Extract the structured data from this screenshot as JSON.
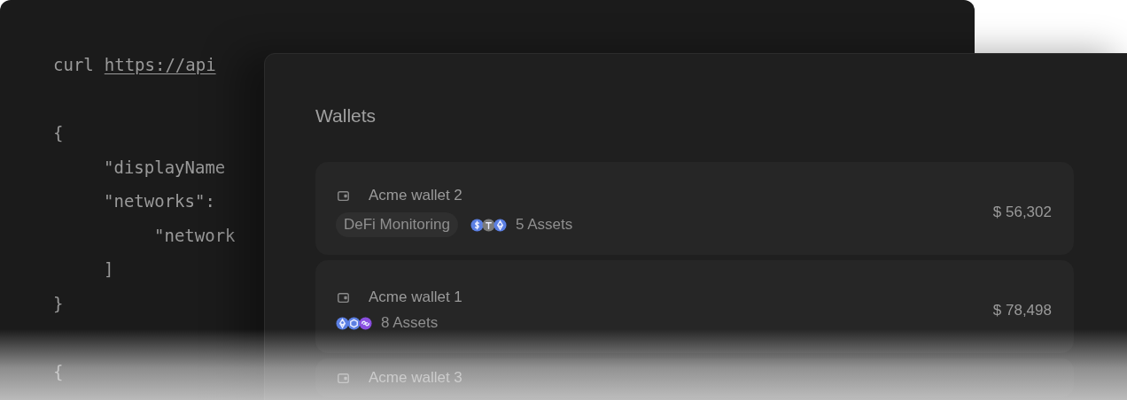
{
  "code_panel": {
    "lines": [
      {
        "kind": "code",
        "parts": [
          {
            "kind": "text",
            "text": "curl"
          },
          {
            "kind": "link",
            "text": "https://api"
          }
        ]
      },
      {
        "kind": "blank"
      },
      {
        "kind": "code",
        "parts": [
          {
            "kind": "text",
            "text": "{"
          }
        ],
        "children": [
          {
            "kind": "code",
            "parts": [
              {
                "kind": "text",
                "text": "\"displayName"
              }
            ]
          },
          {
            "kind": "code",
            "parts": [
              {
                "kind": "text",
                "text": "\"networks\":"
              }
            ],
            "children": [
              {
                "kind": "code",
                "parts": [
                  {
                    "kind": "text",
                    "text": "\"network"
                  }
                ]
              }
            ]
          },
          {
            "kind": "code",
            "parts": [
              {
                "kind": "text",
                "text": "]"
              }
            ]
          }
        ]
      },
      {
        "kind": "code",
        "parts": [
          {
            "kind": "text",
            "text": "}"
          }
        ]
      },
      {
        "kind": "blank"
      },
      {
        "kind": "code",
        "parts": [
          {
            "kind": "text",
            "text": "{"
          }
        ]
      }
    ]
  },
  "wallets_panel": {
    "title": "Wallets",
    "wallets": [
      {
        "name": "Acme wallet 2",
        "tag": "DeFi Monitoring",
        "coins": [
          {
            "color": "#5b7fe3",
            "kind": "dollar"
          },
          {
            "color": "#7a7a7a",
            "kind": "tee"
          },
          {
            "color": "#5b7fe3",
            "kind": "diamond"
          }
        ],
        "assets": "5 Assets",
        "balance": "$ 56,302"
      },
      {
        "name": "Acme wallet 1",
        "coins": [
          {
            "color": "#5b7fe3",
            "kind": "diamond"
          },
          {
            "color": "#5b7fe3",
            "kind": "hex"
          },
          {
            "color": "#8a4fe0",
            "kind": "link"
          }
        ],
        "assets": "8 Assets",
        "balance": "$ 78,498"
      },
      {
        "name": "Acme wallet 3"
      }
    ]
  }
}
